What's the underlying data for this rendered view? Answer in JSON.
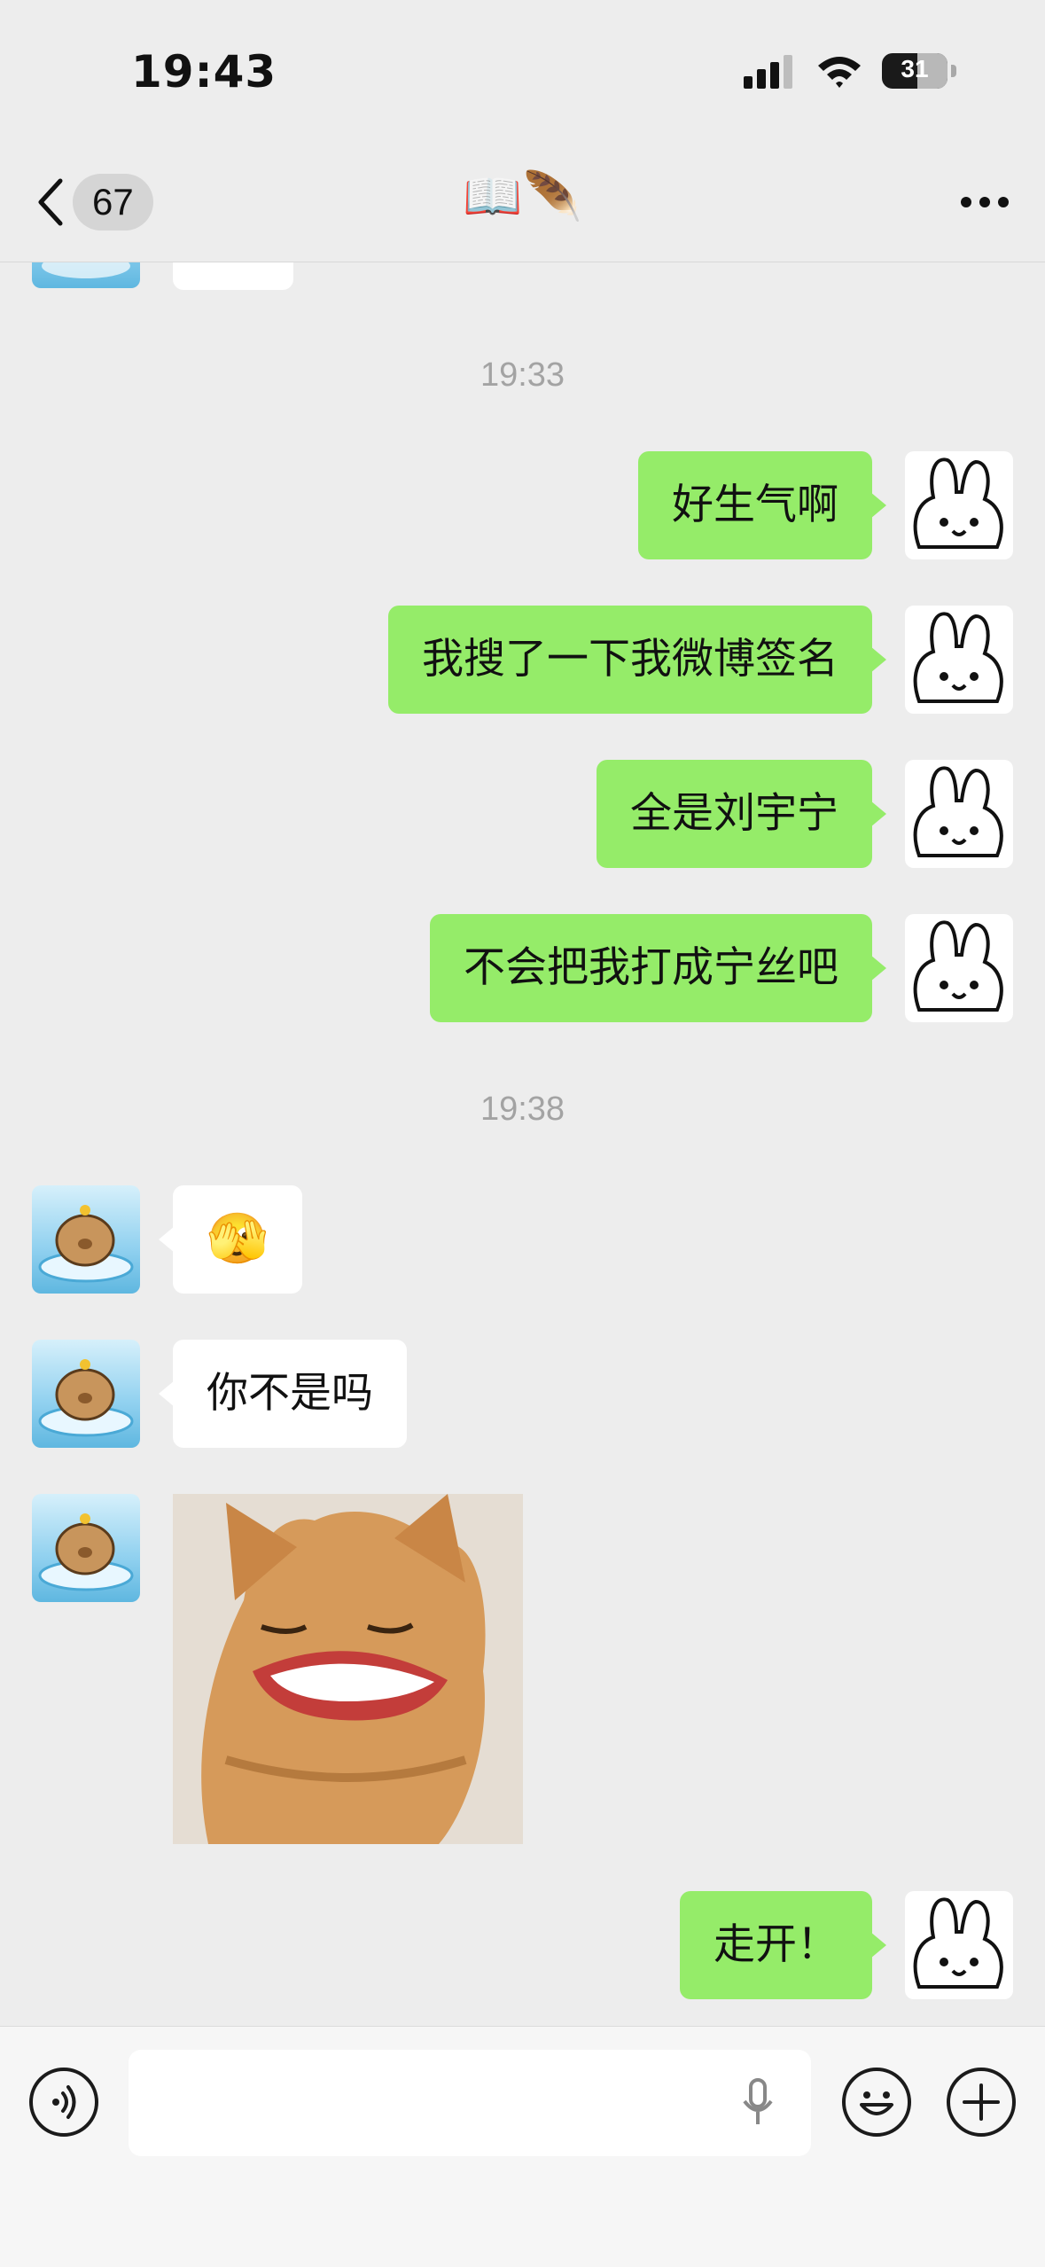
{
  "status": {
    "time": "19:43",
    "battery": "31"
  },
  "nav": {
    "back_count": "67",
    "title": "📖🪶"
  },
  "messages": {
    "ts1": "19:33",
    "m1": "好生气啊",
    "m2": "我搜了一下我微博签名",
    "m3": "全是刘宇宁",
    "m4": "不会把我打成宁丝吧",
    "ts2": "19:38",
    "l1_emoji": "🫣",
    "l2": "你不是吗",
    "m5": "走开！"
  },
  "colors": {
    "sent_bubble": "#95ec69",
    "received_bubble": "#ffffff",
    "background": "#ededed"
  },
  "icons": [
    "back-chevron-icon",
    "more-icon",
    "voice-icon",
    "microphone-icon",
    "emoji-icon",
    "plus-icon"
  ]
}
